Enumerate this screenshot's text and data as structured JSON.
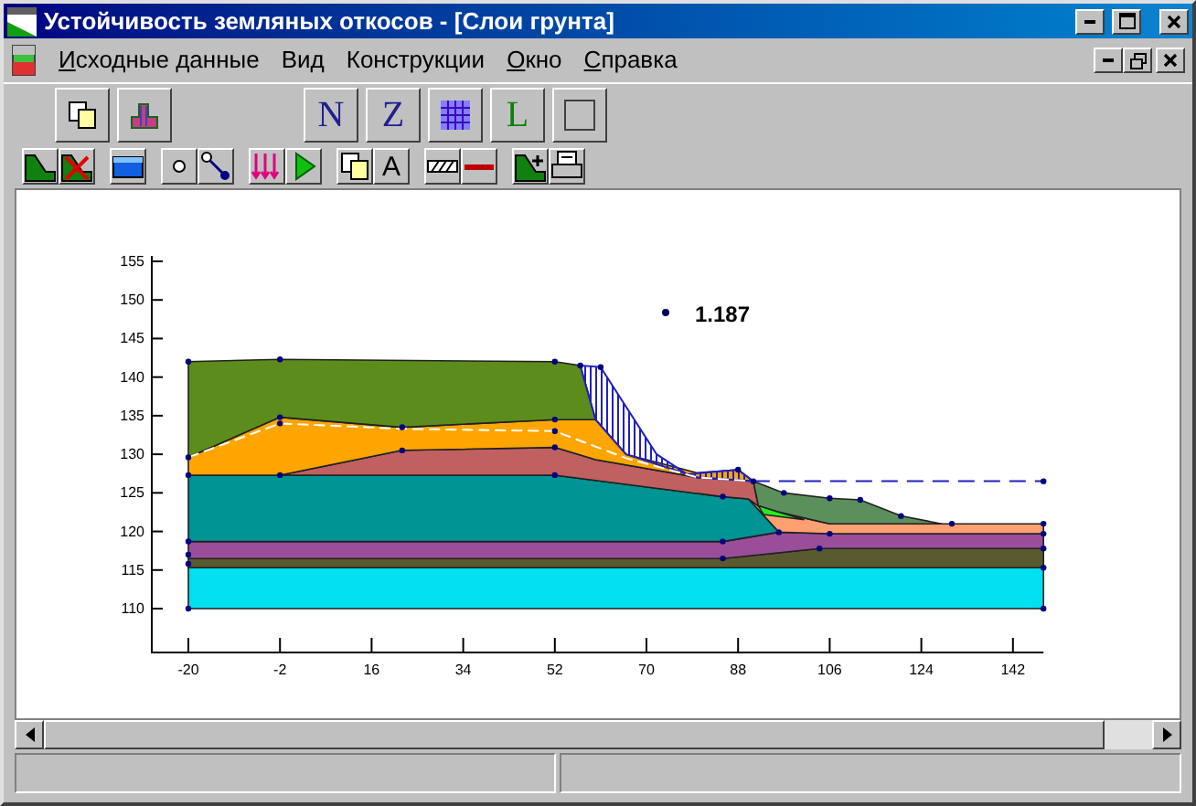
{
  "window": {
    "title": "Устойчивость земляных откосов - [Слои грунта]"
  },
  "menu": [
    {
      "label": "Исходные данные",
      "underline_first": true
    },
    {
      "label": "Вид",
      "underline_first": false
    },
    {
      "label": "Конструкции",
      "underline_first": false
    },
    {
      "label": "Окно",
      "underline_first": true
    },
    {
      "label": "Справка",
      "underline_first": true
    }
  ],
  "toolbar_main": [
    [
      {
        "kind": "copy"
      },
      {
        "kind": "profile"
      }
    ],
    [
      {
        "kind": "letter",
        "text": "N",
        "color": "#202090"
      },
      {
        "kind": "letter",
        "text": "Z",
        "color": "#202090"
      },
      {
        "kind": "grid"
      },
      {
        "kind": "letter",
        "text": "L",
        "color": "#108010"
      },
      {
        "kind": "frame"
      }
    ]
  ],
  "toolbar_tools": [
    [
      {
        "kind": "slope"
      },
      {
        "kind": "slope-delete"
      }
    ],
    [
      {
        "kind": "water"
      }
    ],
    [
      {
        "kind": "point"
      },
      {
        "kind": "link"
      }
    ],
    [
      {
        "kind": "loads"
      },
      {
        "kind": "run"
      }
    ],
    [
      {
        "kind": "copy"
      },
      {
        "kind": "letter",
        "text": "A",
        "color": "#000000"
      }
    ],
    [
      {
        "kind": "hatch"
      },
      {
        "kind": "line"
      }
    ],
    [
      {
        "kind": "slope-add"
      },
      {
        "kind": "print"
      }
    ]
  ],
  "chart": {
    "y_ticks": [
      "155",
      "150",
      "145",
      "140",
      "135",
      "130",
      "125",
      "120",
      "115",
      "110"
    ],
    "x_ticks": [
      "-20",
      "-2",
      "16",
      "34",
      "52",
      "70",
      "88",
      "106",
      "124",
      "142"
    ],
    "factor": "1.187"
  }
}
